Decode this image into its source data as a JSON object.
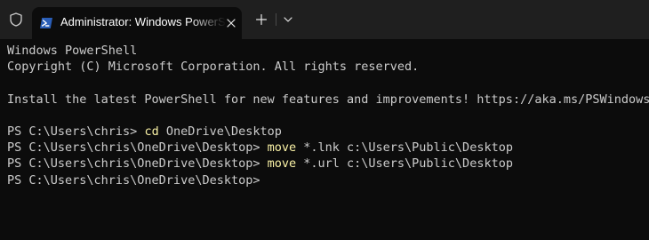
{
  "tab": {
    "title": "Administrator: Windows PowerShell",
    "icon": "powershell-icon"
  },
  "colors": {
    "background": "#0c0c0c",
    "tabbar": "#1f1f1f",
    "text": "#cccccc",
    "command": "#f9f1a5"
  },
  "terminal": {
    "lines": [
      {
        "prompt": "Windows PowerShell"
      },
      {
        "prompt": "Copyright (C) Microsoft Corporation. All rights reserved."
      },
      {
        "prompt": ""
      },
      {
        "prompt": "Install the latest PowerShell for new features and improvements! https://aka.ms/PSWindows"
      },
      {
        "prompt": ""
      },
      {
        "prompt": "PS C:\\Users\\chris> ",
        "command": "cd",
        "args": " OneDrive\\Desktop"
      },
      {
        "prompt": "PS C:\\Users\\chris\\OneDrive\\Desktop> ",
        "command": "move",
        "args": " *.lnk c:\\Users\\Public\\Desktop"
      },
      {
        "prompt": "PS C:\\Users\\chris\\OneDrive\\Desktop> ",
        "command": "move",
        "args": " *.url c:\\Users\\Public\\Desktop"
      },
      {
        "prompt": "PS C:\\Users\\chris\\OneDrive\\Desktop>"
      }
    ]
  }
}
